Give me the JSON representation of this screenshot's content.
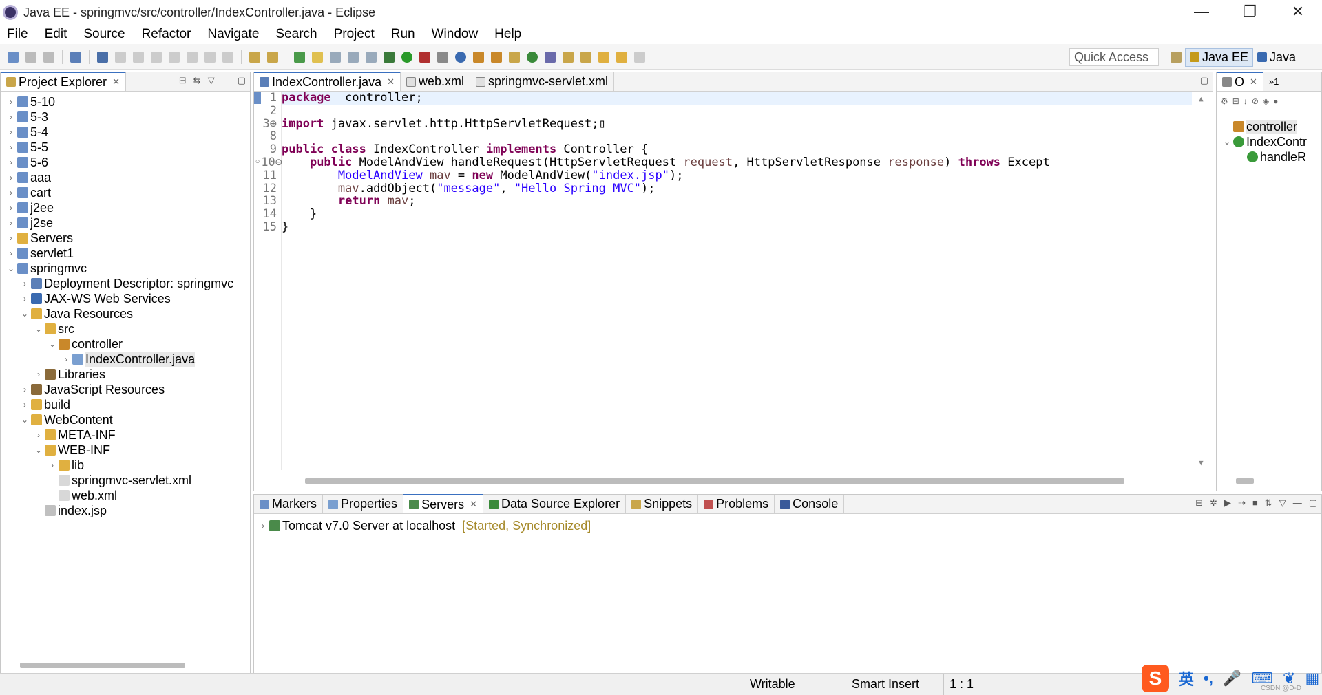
{
  "window": {
    "title": "Java EE - springmvc/src/controller/IndexController.java - Eclipse",
    "controls": [
      "—",
      "❐",
      "✕"
    ]
  },
  "menu": [
    "File",
    "Edit",
    "Source",
    "Refactor",
    "Navigate",
    "Search",
    "Project",
    "Run",
    "Window",
    "Help"
  ],
  "toolbar": {
    "quick_access": "Quick Access",
    "perspectives": [
      "Java EE",
      "Java"
    ]
  },
  "project_explorer": {
    "tab_label": "Project Explorer",
    "items": [
      {
        "label": "5-10",
        "indent": 0,
        "chev": "›",
        "icon": "project-icon"
      },
      {
        "label": "5-3",
        "indent": 0,
        "chev": "›",
        "icon": "project-icon"
      },
      {
        "label": "5-4",
        "indent": 0,
        "chev": "›",
        "icon": "project-icon"
      },
      {
        "label": "5-5",
        "indent": 0,
        "chev": "›",
        "icon": "project-icon"
      },
      {
        "label": "5-6",
        "indent": 0,
        "chev": "›",
        "icon": "project-icon"
      },
      {
        "label": "aaa",
        "indent": 0,
        "chev": "›",
        "icon": "project-icon"
      },
      {
        "label": "cart",
        "indent": 0,
        "chev": "›",
        "icon": "project-icon"
      },
      {
        "label": "j2ee",
        "indent": 0,
        "chev": "›",
        "icon": "project-icon"
      },
      {
        "label": "j2se",
        "indent": 0,
        "chev": "›",
        "icon": "project-icon"
      },
      {
        "label": "Servers",
        "indent": 0,
        "chev": "›",
        "icon": "folder-icon"
      },
      {
        "label": "servlet1",
        "indent": 0,
        "chev": "›",
        "icon": "project-icon"
      },
      {
        "label": "springmvc",
        "indent": 0,
        "chev": "⌄",
        "icon": "project-icon"
      },
      {
        "label": "Deployment Descriptor: springmvc",
        "indent": 1,
        "chev": "›",
        "icon": "descriptor-icon"
      },
      {
        "label": "JAX-WS Web Services",
        "indent": 1,
        "chev": "›",
        "icon": "webservice-icon"
      },
      {
        "label": "Java Resources",
        "indent": 1,
        "chev": "⌄",
        "icon": "folder-icon"
      },
      {
        "label": "src",
        "indent": 2,
        "chev": "⌄",
        "icon": "folder-icon"
      },
      {
        "label": "controller",
        "indent": 3,
        "chev": "⌄",
        "icon": "package-icon"
      },
      {
        "label": "IndexController.java",
        "indent": 4,
        "chev": "›",
        "icon": "java-file-icon",
        "selected": true
      },
      {
        "label": "Libraries",
        "indent": 2,
        "chev": "›",
        "icon": "library-icon"
      },
      {
        "label": "JavaScript Resources",
        "indent": 1,
        "chev": "›",
        "icon": "library-icon"
      },
      {
        "label": "build",
        "indent": 1,
        "chev": "›",
        "icon": "folder-icon"
      },
      {
        "label": "WebContent",
        "indent": 1,
        "chev": "⌄",
        "icon": "folder-icon"
      },
      {
        "label": "META-INF",
        "indent": 2,
        "chev": "›",
        "icon": "folder-icon"
      },
      {
        "label": "WEB-INF",
        "indent": 2,
        "chev": "⌄",
        "icon": "folder-icon"
      },
      {
        "label": "lib",
        "indent": 3,
        "chev": "›",
        "icon": "folder-icon"
      },
      {
        "label": "springmvc-servlet.xml",
        "indent": 3,
        "chev": "",
        "icon": "xml-file-icon"
      },
      {
        "label": "web.xml",
        "indent": 3,
        "chev": "",
        "icon": "xml-file-icon"
      },
      {
        "label": "index.jsp",
        "indent": 2,
        "chev": "",
        "icon": "jsp-file-icon"
      }
    ]
  },
  "editor": {
    "tabs": [
      {
        "label": "IndexController.java",
        "active": true,
        "close": "✕"
      },
      {
        "label": "web.xml",
        "active": false
      },
      {
        "label": "springmvc-servlet.xml",
        "active": false
      }
    ],
    "line_numbers": [
      "1",
      "2",
      "3⊕",
      "8",
      "9",
      "◦10⊖",
      "11",
      "12",
      "13",
      "14",
      "15"
    ],
    "lines": [
      [
        [
          "kw",
          "package"
        ],
        [
          "",
          "  controller;"
        ]
      ],
      [],
      [
        [
          "kw",
          "import"
        ],
        [
          "",
          " javax.servlet.http.HttpServletRequest;▯"
        ]
      ],
      [],
      [
        [
          "kw",
          "public class"
        ],
        [
          "",
          " IndexController "
        ],
        [
          "kw",
          "implements"
        ],
        [
          "",
          " Controller {"
        ]
      ],
      [
        [
          "",
          "    "
        ],
        [
          "kw",
          "public"
        ],
        [
          "",
          " ModelAndView handleRequest(HttpServletRequest "
        ],
        [
          "param",
          "request"
        ],
        [
          "",
          ", HttpServletResponse "
        ],
        [
          "param",
          "response"
        ],
        [
          "",
          ") "
        ],
        [
          "kw",
          "throws"
        ],
        [
          "",
          " Except"
        ]
      ],
      [
        [
          "",
          "        "
        ],
        [
          "typelink",
          "ModelAndView"
        ],
        [
          "",
          " "
        ],
        [
          "param",
          "mav"
        ],
        [
          "",
          " = "
        ],
        [
          "kw",
          "new"
        ],
        [
          "",
          " ModelAndView("
        ],
        [
          "str",
          "\"index.jsp\""
        ],
        [
          "",
          ");"
        ]
      ],
      [
        [
          "",
          "        "
        ],
        [
          "param",
          "mav"
        ],
        [
          "",
          ".addObject("
        ],
        [
          "str",
          "\"message\""
        ],
        [
          "",
          ", "
        ],
        [
          "str",
          "\"Hello Spring MVC\""
        ],
        [
          "",
          ");"
        ]
      ],
      [
        [
          "",
          "        "
        ],
        [
          "kw",
          "return"
        ],
        [
          "",
          " "
        ],
        [
          "param",
          "mav"
        ],
        [
          "",
          ";"
        ]
      ],
      [
        [
          "",
          "    }"
        ]
      ],
      [
        [
          "",
          "}"
        ]
      ]
    ]
  },
  "outline": {
    "tabs": [
      "O",
      "»1"
    ],
    "items": [
      {
        "label": "controller",
        "indent": 0,
        "chev": "",
        "icon": "package-icon",
        "selected": true
      },
      {
        "label": "IndexContr",
        "indent": 0,
        "chev": "⌄",
        "icon": "class-icon"
      },
      {
        "label": "handleR",
        "indent": 1,
        "chev": "",
        "icon": "method-icon"
      }
    ]
  },
  "bottom_panel": {
    "tabs": [
      "Markers",
      "Properties",
      "Servers",
      "Data Source Explorer",
      "Snippets",
      "Problems",
      "Console"
    ],
    "active_tab": "Servers",
    "close": "✕",
    "server": {
      "name": "Tomcat v7.0 Server at localhost",
      "status": "[Started, Synchronized]"
    }
  },
  "status": {
    "writable": "Writable",
    "insert_mode": "Smart Insert",
    "position": "1 : 1"
  },
  "ime": {
    "logo": "S",
    "lang": "英",
    "punct": "•,",
    "watermark": "CSDN @D-D"
  },
  "colors": {
    "keyword": "#7f0055",
    "string": "#2a00ff",
    "server_status": "#a68a2a"
  }
}
